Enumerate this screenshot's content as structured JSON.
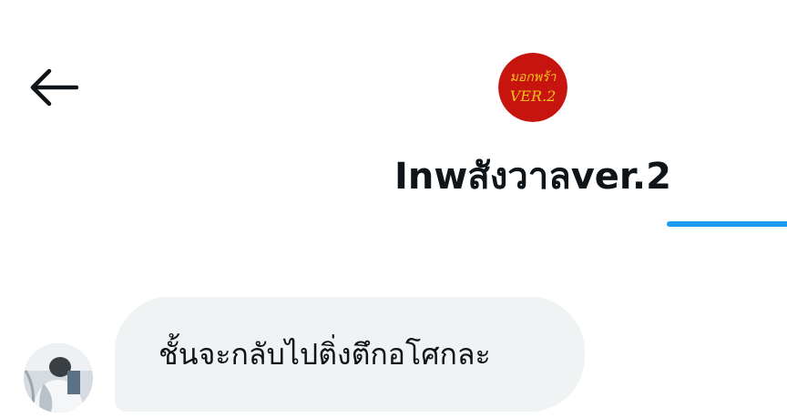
{
  "header": {
    "back_icon": "arrow-left-icon",
    "avatar_text_line1": "มอกพร้า",
    "avatar_text_line2": "VER.2",
    "title": "Inwสังวาลver.2",
    "accent_color": "#1d9bf0"
  },
  "conversation": {
    "messages": [
      {
        "sender": "other",
        "text": "ชั้นจะกลับไปติ่งตึกอโศกละ"
      }
    ]
  },
  "colors": {
    "bubble_background": "#eff3f4",
    "text": "#0f1419",
    "avatar_red": "#c8140f"
  }
}
